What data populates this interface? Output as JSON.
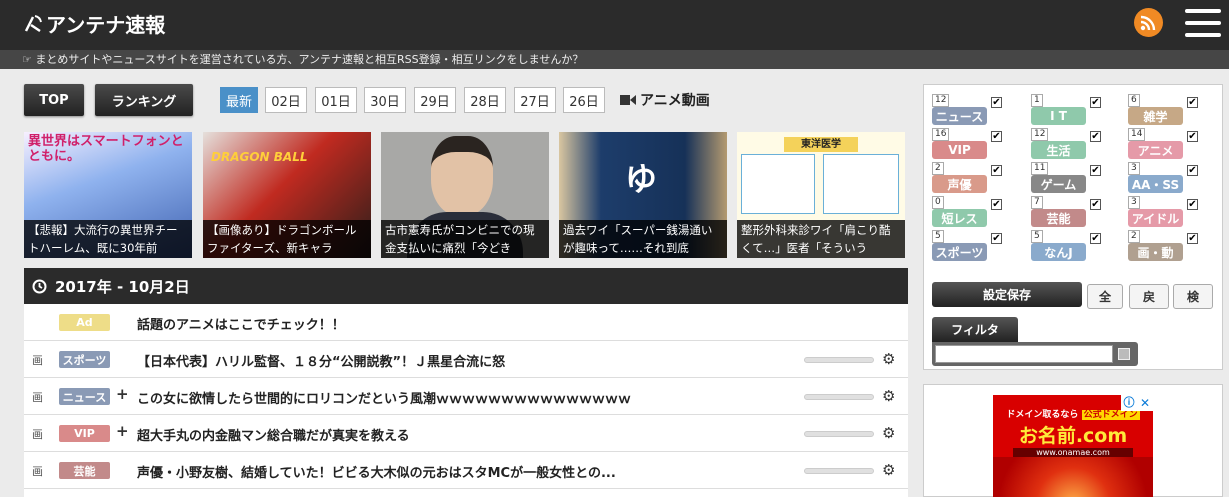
{
  "header": {
    "logo": "アンテナ速報",
    "logo_icon": "wifi-antenna-icon"
  },
  "notice": "まとめサイトやニュースサイトを運営されている方、アンテナ速報と相互RSS登録・相互リンクをしませんか？",
  "nav": {
    "top": "TOP",
    "ranking": "ランキング"
  },
  "dates": [
    "最新",
    "02日",
    "01日",
    "30日",
    "29日",
    "28日",
    "27日",
    "26日"
  ],
  "anime_video": "アニメ動画",
  "thumbs": [
    {
      "caption": "【悲報】大流行の異世界チートハーレム、既に30年前",
      "bg": "#5a7fc4"
    },
    {
      "caption": "【画像あり】ドラゴンボールファイターズ、新キャラ",
      "bg": "#b83a2a"
    },
    {
      "caption": "古市憲寿氏がコンビニでの現金支払いに痛烈「今どき",
      "bg": "#9a9a98"
    },
    {
      "caption": "過去ワイ「スーパー銭湯通いが趣味って……それ到底",
      "bg": "#1d3d6b"
    },
    {
      "caption": "整形外科来診ワイ「肩こり酷くて…」医者「そういう",
      "bg": "#f3e6a6"
    }
  ],
  "thumb_text": {
    "t1": "異世界はスマートフォンとともに。",
    "t2": "DRAGON BALL",
    "t5": "東洋医学"
  },
  "date_header": "2017年 - 10月2日",
  "rows": [
    {
      "ga": "",
      "cat": "Ad",
      "color": "#eedd88",
      "plus": "",
      "title": "話題のアニメはここでチェック！！"
    },
    {
      "ga": "画",
      "cat": "スポーツ",
      "color": "#8a9ab5",
      "plus": "",
      "title": "【日本代表】ハリル監督、１８分“公開説教”！Ｊ黒星合流に怒"
    },
    {
      "ga": "画",
      "cat": "ニュース",
      "color": "#8a9ab5",
      "plus": "+",
      "title": "この女に欲情したら世間的にロリコンだという風潮ｗｗｗｗｗｗｗｗｗｗｗｗｗｗｗ"
    },
    {
      "ga": "画",
      "cat": "VIP",
      "color": "#d98a8a",
      "plus": "+",
      "title": "超大手丸の内金融マン総合職だが真実を教える"
    },
    {
      "ga": "画",
      "cat": "芸能",
      "color": "#c28a8a",
      "plus": "",
      "title": "声優・小野友樹、結婚していた！ビビる大木似の元おはスタMCが一般女性との..."
    }
  ],
  "categories": [
    {
      "count": "12",
      "label": "ニュース",
      "color": "#8a9ab5"
    },
    {
      "count": "1",
      "label": "I T",
      "color": "#8fc9ab"
    },
    {
      "count": "6",
      "label": "雑学",
      "color": "#c6a886"
    },
    {
      "count": "16",
      "label": "VIP",
      "color": "#d98a8a"
    },
    {
      "count": "12",
      "label": "生活",
      "color": "#8fc9ab"
    },
    {
      "count": "14",
      "label": "アニメ",
      "color": "#e59aa8"
    },
    {
      "count": "2",
      "label": "声優",
      "color": "#d99a8a"
    },
    {
      "count": "11",
      "label": "ゲーム",
      "color": "#888888"
    },
    {
      "count": "3",
      "label": "AA・SS",
      "color": "#8aaacc"
    },
    {
      "count": "0",
      "label": "短レス",
      "color": "#8fc9ab"
    },
    {
      "count": "7",
      "label": "芸能",
      "color": "#c28a8a"
    },
    {
      "count": "3",
      "label": "アイドル",
      "color": "#e59aa8"
    },
    {
      "count": "5",
      "label": "スポーツ",
      "color": "#8a9ab5"
    },
    {
      "count": "5",
      "label": "なんJ",
      "color": "#8aaacc"
    },
    {
      "count": "2",
      "label": "画・動",
      "color": "#b0a090"
    }
  ],
  "settings": {
    "save": "設定保存",
    "all": "全",
    "back": "戻",
    "check": "検",
    "filter": "フィルタ",
    "filter_value": ""
  },
  "ad": {
    "line1": "ドメイン取るなら",
    "badge": "公式ドメイン",
    "brand": "お名前.com",
    "url": "www.onamae.com",
    "info_icon": "info-icon",
    "close_icon": "close-icon"
  }
}
